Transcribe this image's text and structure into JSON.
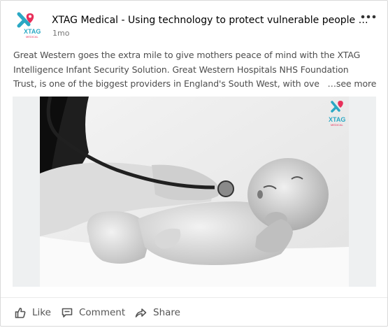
{
  "post": {
    "title": "XTAG Medical - Using technology to protect vulnerable people and val...",
    "age": "1mo",
    "logo_text": "XTAG",
    "logo_subtext": "MEDICAL",
    "body_lines": [
      "Great Western goes the extra mile to give mothers peace of mind with the XTAG",
      "Intelligence Infant Security Solution. Great Western Hospitals NHS Foundation",
      "Trust, is one of the biggest providers in England's South West, with ove"
    ],
    "see_more": "…see more",
    "image_logo_text": "XTAG",
    "image_logo_subtext": "MEDICAL"
  },
  "actions": {
    "like": "Like",
    "comment": "Comment",
    "share": "Share"
  },
  "colors": {
    "brand_teal": "#2aa8c4",
    "brand_pink": "#e8305a"
  },
  "icons": {
    "more": "more-dots-icon",
    "like": "thumbs-up-icon",
    "comment": "comment-icon",
    "share": "share-arrow-icon"
  }
}
